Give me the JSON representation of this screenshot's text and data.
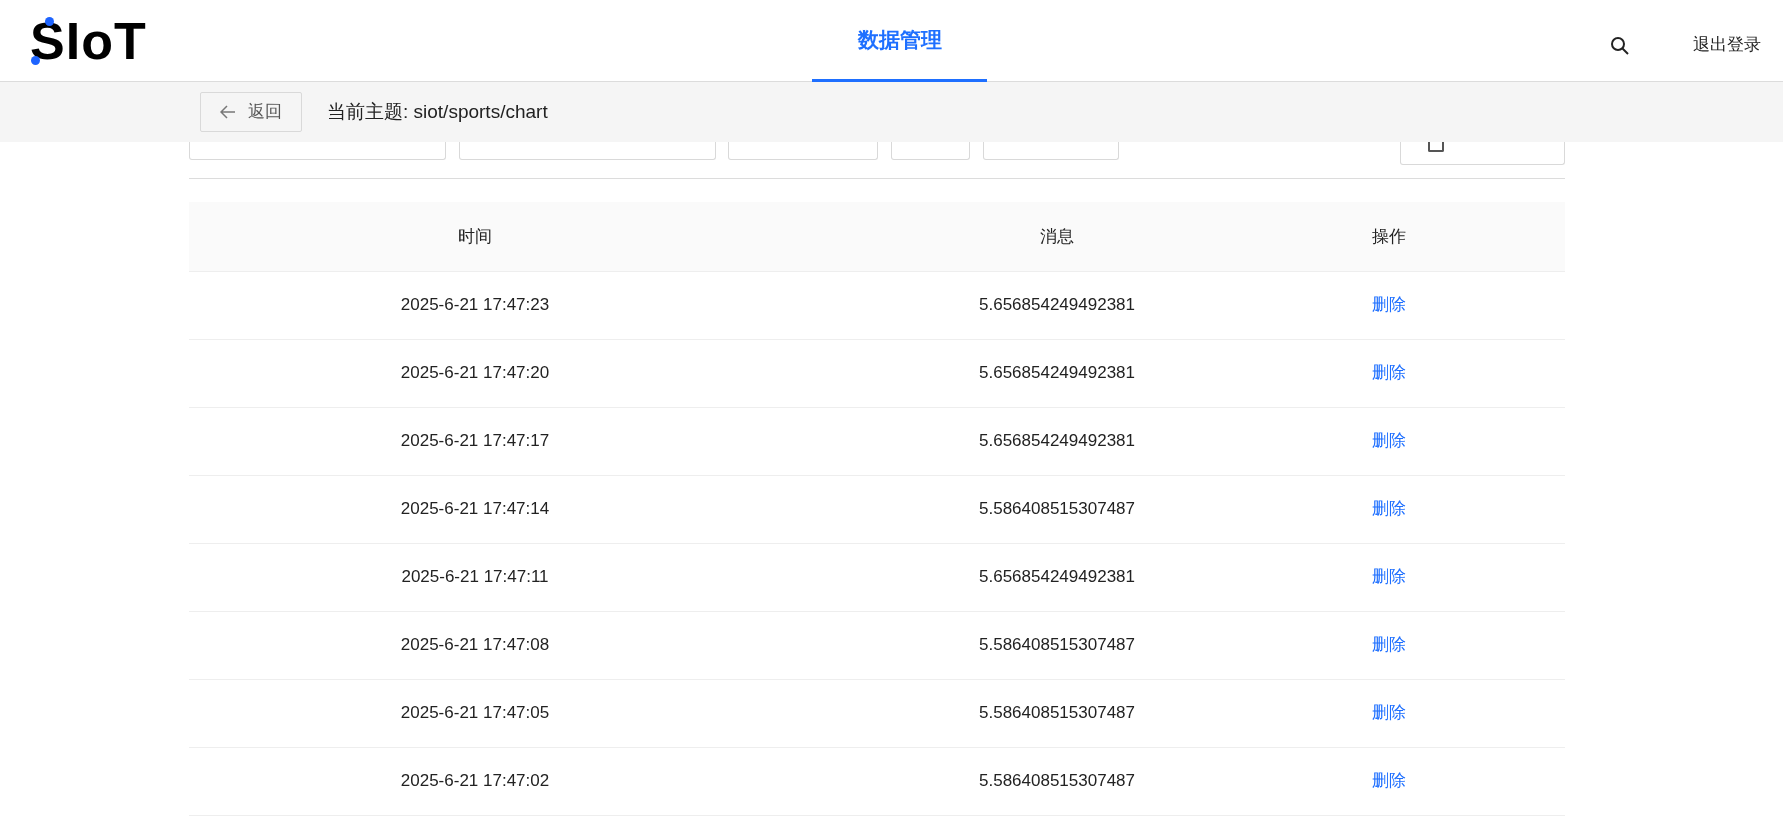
{
  "header": {
    "logo": "SIoT",
    "nav": [
      {
        "label": "数据管理",
        "selected": true
      }
    ],
    "logout": "退出登录"
  },
  "subbar": {
    "back": "返回",
    "topic": "当前主题: siot/sports/chart"
  },
  "auto_refresh": {
    "checked": false
  },
  "table": {
    "columns": [
      "时间",
      "消息",
      "操作"
    ],
    "rows": [
      {
        "time": "2025-6-21 17:47:23",
        "message": "5.656854249492381",
        "action": "删除"
      },
      {
        "time": "2025-6-21 17:47:20",
        "message": "5.656854249492381",
        "action": "删除"
      },
      {
        "time": "2025-6-21 17:47:17",
        "message": "5.656854249492381",
        "action": "删除"
      },
      {
        "time": "2025-6-21 17:47:14",
        "message": "5.586408515307487",
        "action": "删除"
      },
      {
        "time": "2025-6-21 17:47:11",
        "message": "5.656854249492381",
        "action": "删除"
      },
      {
        "time": "2025-6-21 17:47:08",
        "message": "5.586408515307487",
        "action": "删除"
      },
      {
        "time": "2025-6-21 17:47:05",
        "message": "5.586408515307487",
        "action": "删除"
      },
      {
        "time": "2025-6-21 17:47:02",
        "message": "5.586408515307487",
        "action": "删除"
      }
    ]
  }
}
